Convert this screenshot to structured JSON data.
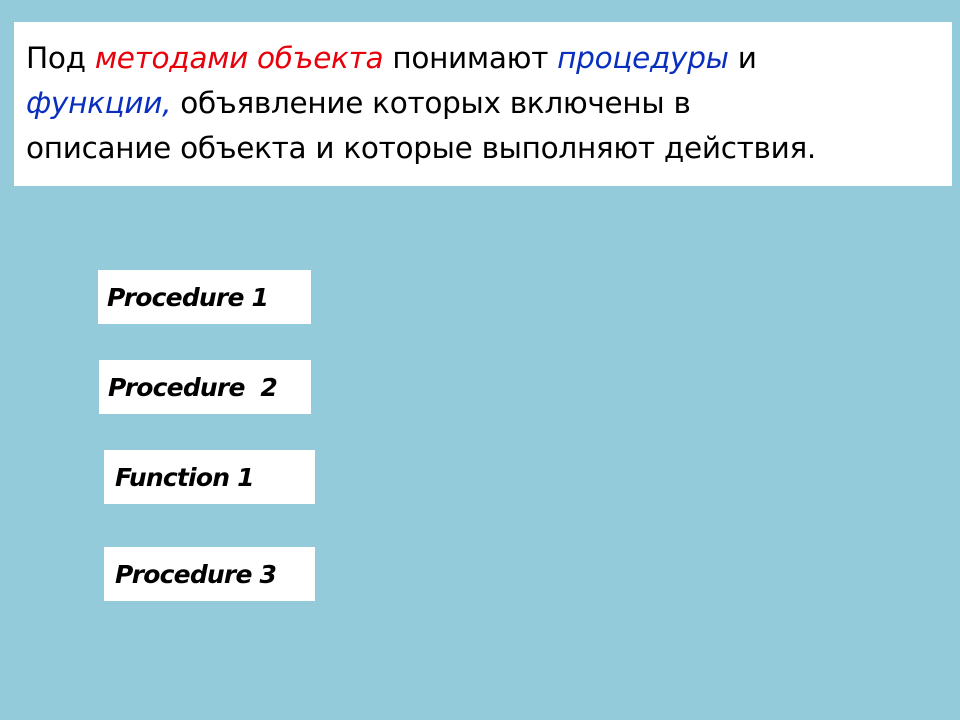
{
  "definition": {
    "line1": {
      "part1": "Под  ",
      "highlight_red": "методами объекта",
      "part2": " понимают ",
      "highlight_blue": "процедуры",
      "part3": " и"
    },
    "line2": {
      "highlight_blue": "функции,",
      "part1": " объявление которых включены в"
    },
    "line3": "описание объекта и которые выполняют действия.",
    "colors": {
      "red": "#e8000b",
      "blue": "#0a2fbf",
      "text": "#000000",
      "background": "#94cbdb"
    }
  },
  "methods": [
    {
      "label": "Procedure 1"
    },
    {
      "label": "Procedure  2"
    },
    {
      "label": "Function 1"
    },
    {
      "label": "Procedure 3"
    }
  ]
}
